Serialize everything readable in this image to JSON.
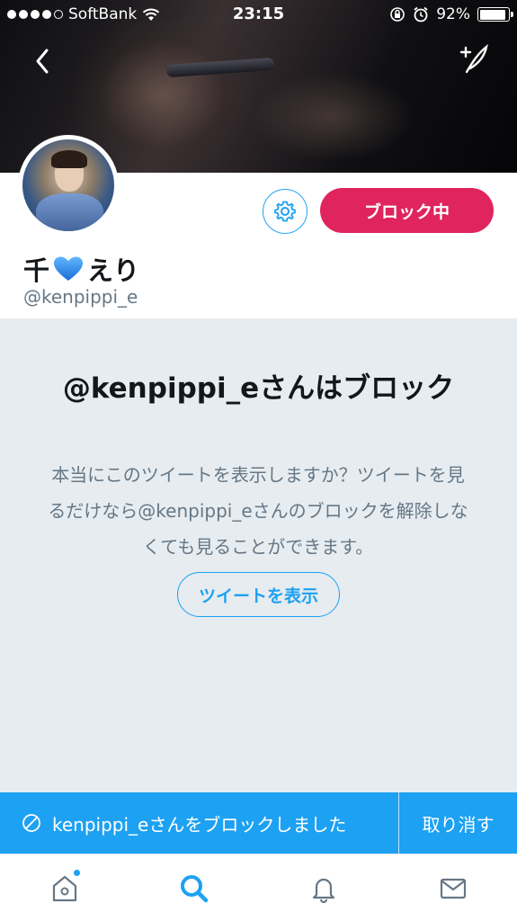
{
  "status_bar": {
    "carrier": "SoftBank",
    "time": "23:15",
    "battery": "92%",
    "battery_level": 0.92
  },
  "header": {
    "back_icon": "chevron-left-icon",
    "compose_icon": "compose-feather-icon"
  },
  "profile": {
    "name_prefix": "千",
    "name_suffix": "えり",
    "name_emoji": "blue-heart",
    "screen_name": "@kenpippi_e",
    "block_button_label": "ブロック中",
    "settings_icon": "gear-icon"
  },
  "notice": {
    "title": "@kenpippi_eさんはブロック",
    "body": "本当にこのツイートを表示しますか？ツイートを見るだけなら@kenpippi_eさんのブロックを解除しなくても見ることができます。",
    "show_button_label": "ツイートを表示"
  },
  "toast": {
    "message": "kenpippi_eさんをブロックしました",
    "undo_label": "取り消す",
    "icon": "no-entry-icon"
  },
  "tabbar": {
    "items": [
      {
        "name": "home",
        "icon": "home-icon",
        "active": false,
        "badge": true
      },
      {
        "name": "search",
        "icon": "search-icon",
        "active": true,
        "badge": false
      },
      {
        "name": "notifications",
        "icon": "bell-icon",
        "active": false,
        "badge": false
      },
      {
        "name": "messages",
        "icon": "envelope-icon",
        "active": false,
        "badge": false
      }
    ]
  },
  "colors": {
    "accent": "#1da1f2",
    "block_red": "#e0245e",
    "background": "#e6ecf0",
    "secondary_text": "#657786"
  }
}
